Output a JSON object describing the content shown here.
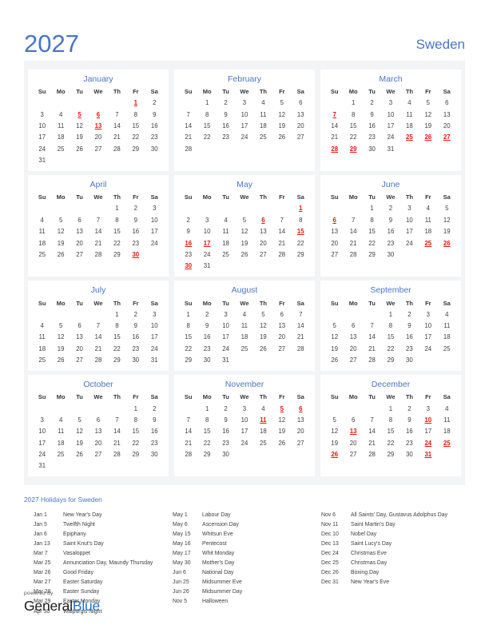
{
  "header": {
    "year": "2027",
    "country": "Sweden"
  },
  "colors": {
    "accent_blue": "#4a75c7",
    "holiday_red": "#e8140c",
    "panel_bg": "#f3f4f6",
    "card_bg": "#ffffff",
    "logo_blue": "#1f72c4"
  },
  "weekday_headers": [
    "Su",
    "Mo",
    "Tu",
    "We",
    "Th",
    "Fr",
    "Sa"
  ],
  "months": [
    {
      "name": "January",
      "lead_blanks": 5,
      "days": 31,
      "holidays": [
        1,
        5,
        6,
        13
      ]
    },
    {
      "name": "February",
      "lead_blanks": 1,
      "days": 28,
      "holidays": []
    },
    {
      "name": "March",
      "lead_blanks": 1,
      "days": 31,
      "holidays": [
        7,
        25,
        26,
        27,
        28,
        29
      ]
    },
    {
      "name": "April",
      "lead_blanks": 4,
      "days": 30,
      "holidays": [
        30
      ]
    },
    {
      "name": "May",
      "lead_blanks": 6,
      "days": 31,
      "holidays": [
        1,
        6,
        15,
        16,
        17,
        30
      ]
    },
    {
      "name": "June",
      "lead_blanks": 2,
      "days": 30,
      "holidays": [
        6,
        25,
        26
      ]
    },
    {
      "name": "July",
      "lead_blanks": 4,
      "days": 31,
      "holidays": []
    },
    {
      "name": "August",
      "lead_blanks": 0,
      "days": 31,
      "holidays": []
    },
    {
      "name": "September",
      "lead_blanks": 3,
      "days": 30,
      "holidays": []
    },
    {
      "name": "October",
      "lead_blanks": 5,
      "days": 31,
      "holidays": []
    },
    {
      "name": "November",
      "lead_blanks": 1,
      "days": 30,
      "holidays": [
        5,
        6,
        11
      ]
    },
    {
      "name": "December",
      "lead_blanks": 3,
      "days": 31,
      "holidays": [
        10,
        13,
        24,
        25,
        26,
        31
      ]
    }
  ],
  "holidays_section": {
    "heading": "2027 Holidays for Sweden",
    "columns": [
      [
        {
          "date": "Jan 1",
          "name": "New Year's Day"
        },
        {
          "date": "Jan 5",
          "name": "Twelfth Night"
        },
        {
          "date": "Jan 6",
          "name": "Epiphany"
        },
        {
          "date": "Jan 13",
          "name": "Saint Knut's Day"
        },
        {
          "date": "Mar 7",
          "name": "Vasaloppet"
        },
        {
          "date": "Mar 25",
          "name": "Annunciation Day, Maundy Thursday"
        },
        {
          "date": "Mar 26",
          "name": "Good Friday"
        },
        {
          "date": "Mar 27",
          "name": "Easter Saturday"
        },
        {
          "date": "Mar 28",
          "name": "Easter Sunday"
        },
        {
          "date": "Mar 29",
          "name": "Easter Monday"
        },
        {
          "date": "Apr 30",
          "name": "Walpurgis Night"
        }
      ],
      [
        {
          "date": "May 1",
          "name": "Labour Day"
        },
        {
          "date": "May 6",
          "name": "Ascension Day"
        },
        {
          "date": "May 15",
          "name": "Whitsun Eve"
        },
        {
          "date": "May 16",
          "name": "Pentecost"
        },
        {
          "date": "May 17",
          "name": "Whit Monday"
        },
        {
          "date": "May 30",
          "name": "Mother's Day"
        },
        {
          "date": "Jun 6",
          "name": "National Day"
        },
        {
          "date": "Jun 25",
          "name": "Midsummer Eve"
        },
        {
          "date": "Jun 26",
          "name": "Midsummer Day"
        },
        {
          "date": "Nov 5",
          "name": "Halloween"
        }
      ],
      [
        {
          "date": "Nov 6",
          "name": "All Saints' Day, Gustavus Adolphus Day"
        },
        {
          "date": "Nov 11",
          "name": "Saint Martin's Day"
        },
        {
          "date": "Dec 10",
          "name": "Nobel Day"
        },
        {
          "date": "Dec 13",
          "name": "Saint Lucy's Day"
        },
        {
          "date": "Dec 24",
          "name": "Christmas Eve"
        },
        {
          "date": "Dec 25",
          "name": "Christmas Day"
        },
        {
          "date": "Dec 26",
          "name": "Boxing Day"
        },
        {
          "date": "Dec 31",
          "name": "New Year's Eve"
        }
      ]
    ]
  },
  "footer": {
    "powered_by": "powered by",
    "logo_part_1": "General",
    "logo_part_2": "Blue"
  }
}
